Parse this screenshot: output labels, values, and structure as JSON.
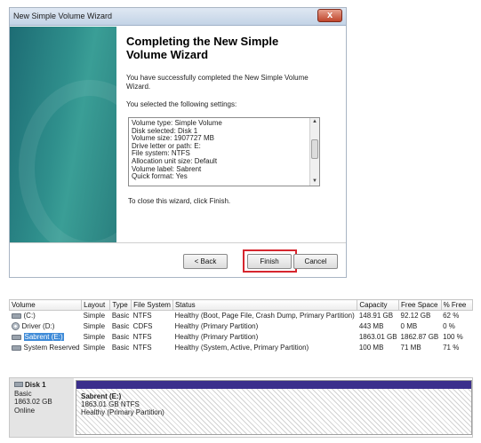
{
  "wizard": {
    "title": "New Simple Volume Wizard",
    "close_glyph": "x",
    "heading_line1": "Completing the New Simple",
    "heading_line2": "Volume Wizard",
    "success_line1": "You have successfully completed the New Simple Volume",
    "success_line2": "Wizard.",
    "settings_intro": "You selected the following settings:",
    "settings": [
      "Volume type: Simple Volume",
      "Disk selected: Disk 1",
      "Volume size: 1907727 MB",
      "Drive letter or path: E:",
      "File system: NTFS",
      "Allocation unit size: Default",
      "Volume label: Sabrent",
      "Quick format: Yes"
    ],
    "close_note": "To close this wizard, click Finish.",
    "back_label": "< Back",
    "finish_label": "Finish",
    "cancel_label": "Cancel",
    "highlight_color": "#d6262e"
  },
  "volume_list": {
    "columns": [
      "Volume",
      "Layout",
      "Type",
      "File System",
      "Status",
      "Capacity",
      "Free Space",
      "% Free"
    ],
    "rows": [
      {
        "volume": "(C:)",
        "icon": "drive-icon",
        "layout": "Simple",
        "type": "Basic",
        "fs": "NTFS",
        "status": "Healthy (Boot, Page File, Crash Dump, Primary Partition)",
        "capacity": "148.91 GB",
        "free": "92.12 GB",
        "pct": "62 %"
      },
      {
        "volume": "Driver (D:)",
        "icon": "cd-icon",
        "layout": "Simple",
        "type": "Basic",
        "fs": "CDFS",
        "status": "Healthy (Primary Partition)",
        "capacity": "443 MB",
        "free": "0 MB",
        "pct": "0 %"
      },
      {
        "volume": "Sabrent (E:)",
        "icon": "drive-icon",
        "layout": "Simple",
        "type": "Basic",
        "fs": "NTFS",
        "status": "Healthy (Primary Partition)",
        "capacity": "1863.01 GB",
        "free": "1862.87 GB",
        "pct": "100 %"
      },
      {
        "volume": "System Reserved",
        "icon": "drive-icon",
        "layout": "Simple",
        "type": "Basic",
        "fs": "NTFS",
        "status": "Healthy (System, Active, Primary Partition)",
        "capacity": "100 MB",
        "free": "71 MB",
        "pct": "71 %"
      }
    ]
  },
  "disk": {
    "name": "Disk 1",
    "type": "Basic",
    "size": "1863.02 GB",
    "state": "Online",
    "partition_name": "Sabrent (E:)",
    "partition_size": "1863.01 GB NTFS",
    "partition_status": "Healthy (Primary Partition)",
    "partition_color": "#3b2f8c"
  }
}
